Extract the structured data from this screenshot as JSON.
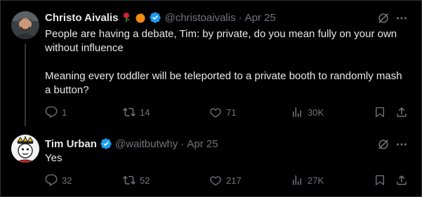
{
  "tweets": [
    {
      "name": "Christo Aivalis",
      "handle": "@christoaivalis",
      "separator": "·",
      "date": "Apr 25",
      "text_line1": "People are having a debate, Tim: by private, do you mean fully on your own\nwithout influence",
      "text_line2": "Meaning every toddler will be teleported to a private booth to randomly mash\na button?",
      "counts": {
        "replies": "1",
        "reposts": "14",
        "likes": "71",
        "views": "30K"
      },
      "icons": [
        "rose-emoji-icon",
        "orange-emoji-icon",
        "verified-badge-icon"
      ]
    },
    {
      "name": "Tim Urban",
      "handle": "@waitbutwhy",
      "separator": "·",
      "date": "Apr 25",
      "text": "Yes",
      "counts": {
        "replies": "32",
        "reposts": "52",
        "likes": "217",
        "views": "27K"
      },
      "icons": [
        "verified-badge-icon"
      ]
    }
  ],
  "colors": {
    "background": "#000000",
    "text": "#e7e9ea",
    "muted": "#71767b",
    "verified": "#1d9bf0",
    "border": "#2f3336"
  }
}
